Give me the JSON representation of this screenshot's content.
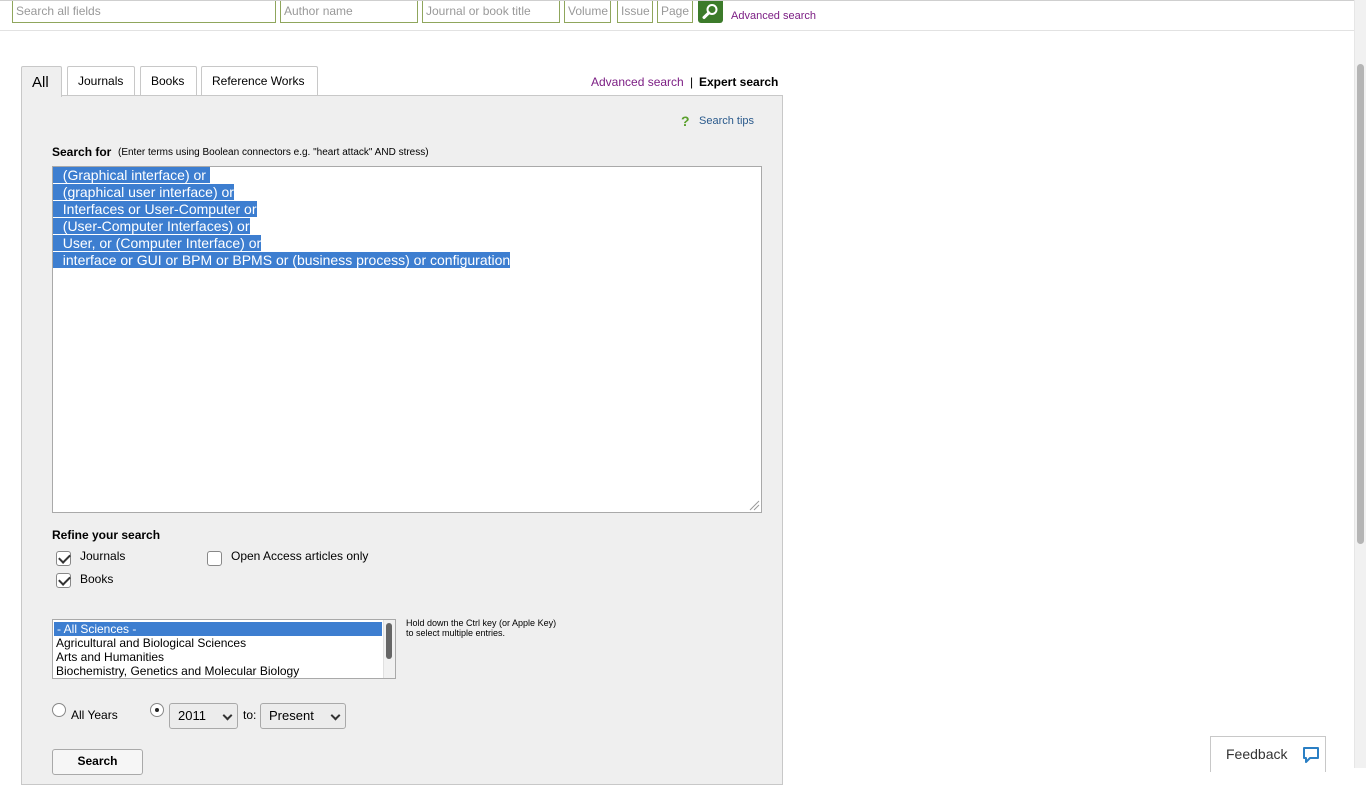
{
  "quick_search": {
    "all_fields_placeholder": "Search all fields",
    "author_placeholder": "Author name",
    "journal_placeholder": "Journal or book title",
    "volume_placeholder": "Volume",
    "issue_placeholder": "Issue",
    "page_placeholder": "Page",
    "advanced_link": "Advanced search"
  },
  "tabs": [
    {
      "label": "All",
      "active": true
    },
    {
      "label": "Journals",
      "active": false
    },
    {
      "label": "Books",
      "active": false
    },
    {
      "label": "Reference Works",
      "active": false
    }
  ],
  "mode_links": {
    "advanced": "Advanced search",
    "separator": "|",
    "expert": "Expert search"
  },
  "search_tips": "Search tips",
  "search_for": {
    "label": "Search for",
    "hint": "(Enter terms using Boolean connectors e.g. \"heart attack\" AND stress)",
    "query_lines": [
      "  (Graphical interface) or ",
      "  (graphical user interface) or",
      "  Interfaces or User-Computer or",
      "  (User-Computer Interfaces) or",
      "  User, or (Computer Interface) or",
      "  interface or GUI or BPM or BPMS or (business process) or configuration"
    ]
  },
  "refine": {
    "title": "Refine your search",
    "journals_label": "Journals",
    "journals_checked": true,
    "books_label": "Books",
    "books_checked": true,
    "open_access_label": "Open Access articles only",
    "open_access_checked": false
  },
  "subjects": {
    "items": [
      "- All Sciences -",
      "Agricultural and Biological Sciences",
      "Arts and Humanities",
      "Biochemistry, Genetics and Molecular Biology"
    ],
    "selected_index": 0,
    "hint_line1": "Hold down the Ctrl key (or Apple Key)",
    "hint_line2": "to select multiple entries."
  },
  "years": {
    "all_years_label": "All Years",
    "range_selected": true,
    "from_value": "2011",
    "to_label": "to:",
    "to_value": "Present"
  },
  "search_button": "Search",
  "feedback": "Feedback",
  "colors": {
    "accent_green": "#3c7b2a",
    "link_purple": "#7c1e84",
    "selection_blue": "#3d7ed0"
  }
}
